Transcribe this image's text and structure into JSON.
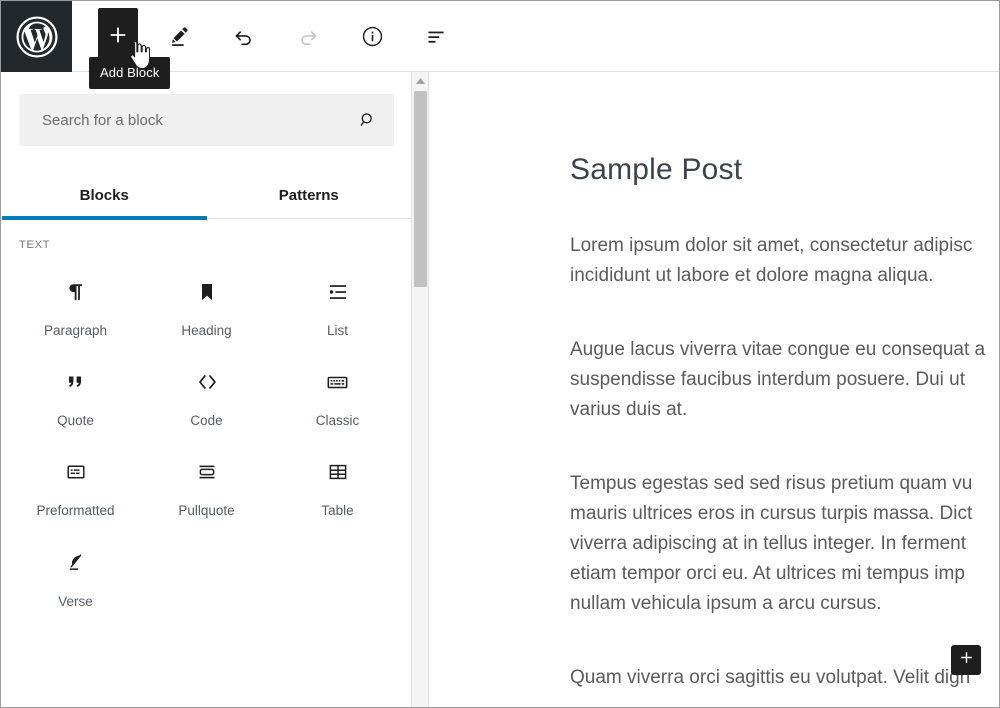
{
  "theme": {
    "accent": "#007cba",
    "dark": "#1e1e1e",
    "logo_bg": "#23282d"
  },
  "toolbar": {
    "logo_name": "wordpress-logo",
    "add_block_label": "Add Block",
    "tooltip_text": "Add Block",
    "buttons": [
      {
        "name": "add-block-button",
        "icon": "plus-icon",
        "label": "Add Block",
        "state": "active"
      },
      {
        "name": "edit-tool-button",
        "icon": "pencil-icon",
        "label": "Edit",
        "state": "enabled"
      },
      {
        "name": "undo-button",
        "icon": "undo-arrow-icon",
        "label": "Undo",
        "state": "enabled"
      },
      {
        "name": "redo-button",
        "icon": "redo-arrow-icon",
        "label": "Redo",
        "state": "disabled"
      },
      {
        "name": "details-button",
        "icon": "info-circle-icon",
        "label": "Details",
        "state": "enabled"
      },
      {
        "name": "list-view-button",
        "icon": "list-view-icon",
        "label": "List View",
        "state": "enabled"
      }
    ]
  },
  "inserter": {
    "search": {
      "placeholder": "Search for a block",
      "value": "",
      "icon": "search-icon"
    },
    "tabs": [
      {
        "label": "Blocks",
        "active": true
      },
      {
        "label": "Patterns",
        "active": false
      }
    ],
    "category_label": "TEXT",
    "blocks": [
      {
        "label": "Paragraph",
        "icon": "pilcrow-icon"
      },
      {
        "label": "Heading",
        "icon": "bookmark-icon"
      },
      {
        "label": "List",
        "icon": "list-icon"
      },
      {
        "label": "Quote",
        "icon": "quotation-marks-icon"
      },
      {
        "label": "Code",
        "icon": "angle-brackets-icon"
      },
      {
        "label": "Classic",
        "icon": "keyboard-icon"
      },
      {
        "label": "Preformatted",
        "icon": "preformatted-icon"
      },
      {
        "label": "Pullquote",
        "icon": "pullquote-icon"
      },
      {
        "label": "Table",
        "icon": "table-icon"
      },
      {
        "label": "Verse",
        "icon": "feather-quill-icon"
      }
    ],
    "scrollbar": {
      "name": "inserter-scrollbar"
    }
  },
  "editor": {
    "post_title": "Sample Post",
    "paragraphs": [
      {
        "lines": [
          "Lorem ipsum dolor sit amet, consectetur adipisc",
          "incididunt ut labore et dolore magna aliqua."
        ]
      },
      {
        "lines": [
          "Augue lacus viverra vitae congue eu consequat a",
          "suspendisse faucibus interdum posuere. Dui ut ",
          "varius duis at."
        ]
      },
      {
        "lines": [
          "Tempus egestas sed sed risus pretium quam vu",
          "mauris ultrices eros in cursus turpis massa. Dict",
          "viverra adipiscing at in tellus integer. In ferment",
          "etiam tempor orci eu. At ultrices mi tempus imp",
          "nullam vehicula ipsum a arcu cursus."
        ]
      },
      {
        "lines": [
          "Quam viverra orci sagittis eu volutpat. Velit dign"
        ]
      }
    ],
    "inline_inserter": {
      "name": "block-inserter-button",
      "icon": "plus-icon"
    }
  }
}
